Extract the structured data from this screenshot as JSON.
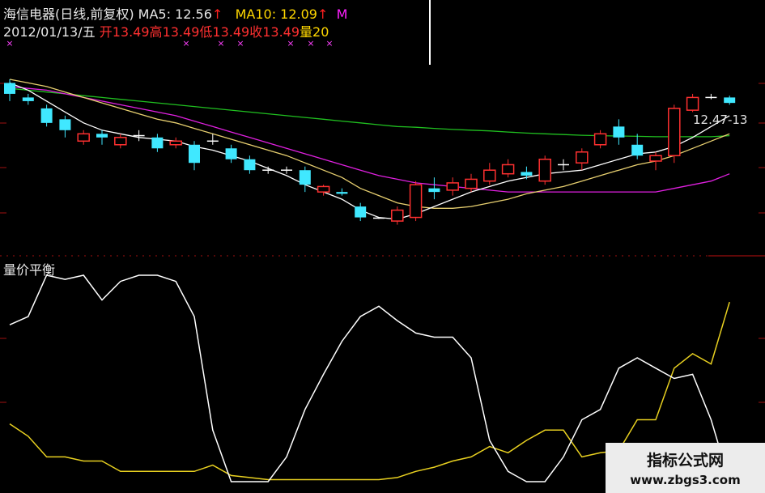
{
  "header": {
    "stock": "海信电器(日线,前复权)",
    "ma5_label": "MA5:",
    "ma5_value": "12.56",
    "ma10_label": "MA10:",
    "ma10_value": "12.09",
    "ma20_label_fragment": "M",
    "up_arrow": "↑",
    "date": "2012/01/13/五",
    "open_label": "开",
    "open_value": "13.49",
    "high_label": "高",
    "high_value": "13.49",
    "low_label": "低",
    "low_value": "13.49",
    "close_label": "收",
    "close_value": "13.49",
    "vol_label": "量",
    "vol_value_fragment": "20"
  },
  "price_label": "12.47-13",
  "sub_indicator_label": "量价平衡",
  "watermark": {
    "title": "指标公式网",
    "url": "www.zbgs3.com"
  },
  "colors": {
    "background": "#000000",
    "up_candle": "#ff3030",
    "down_candle": "#40e8ff",
    "ma5": "#ffffff",
    "ma10": "#e8d070",
    "ma20": "#e020e0",
    "ma60": "#20c020",
    "indicator_white": "#ffffff",
    "indicator_yellow": "#e8d020"
  },
  "chart_data": {
    "type": "candlestick",
    "candles": [
      {
        "o": 13.0,
        "c": 12.7,
        "h": 13.1,
        "l": 12.5
      },
      {
        "o": 12.6,
        "c": 12.5,
        "h": 12.7,
        "l": 12.4
      },
      {
        "o": 12.3,
        "c": 11.9,
        "h": 12.4,
        "l": 11.8
      },
      {
        "o": 12.0,
        "c": 11.7,
        "h": 12.1,
        "l": 11.5
      },
      {
        "o": 11.4,
        "c": 11.6,
        "h": 11.7,
        "l": 11.3
      },
      {
        "o": 11.6,
        "c": 11.5,
        "h": 11.7,
        "l": 11.3
      },
      {
        "o": 11.3,
        "c": 11.5,
        "h": 11.6,
        "l": 11.2
      },
      {
        "o": 11.55,
        "c": 11.55,
        "h": 11.7,
        "l": 11.4
      },
      {
        "o": 11.5,
        "c": 11.2,
        "h": 11.6,
        "l": 11.1
      },
      {
        "o": 11.3,
        "c": 11.4,
        "h": 11.5,
        "l": 11.2
      },
      {
        "o": 11.3,
        "c": 10.8,
        "h": 11.4,
        "l": 10.6
      },
      {
        "o": 11.4,
        "c": 11.4,
        "h": 11.6,
        "l": 11.3
      },
      {
        "o": 11.2,
        "c": 10.9,
        "h": 11.3,
        "l": 10.8
      },
      {
        "o": 10.9,
        "c": 10.6,
        "h": 11.0,
        "l": 10.5
      },
      {
        "o": 10.6,
        "c": 10.6,
        "h": 10.7,
        "l": 10.5
      },
      {
        "o": 10.6,
        "c": 10.6,
        "h": 10.7,
        "l": 10.5
      },
      {
        "o": 10.6,
        "c": 10.2,
        "h": 10.7,
        "l": 10.0
      },
      {
        "o": 10.0,
        "c": 10.15,
        "h": 10.2,
        "l": 9.9
      },
      {
        "o": 10.0,
        "c": 9.95,
        "h": 10.1,
        "l": 9.9
      },
      {
        "o": 9.6,
        "c": 9.3,
        "h": 9.7,
        "l": 9.2
      },
      {
        "o": 9.28,
        "c": 9.28,
        "h": 9.3,
        "l": 9.26
      },
      {
        "o": 9.2,
        "c": 9.5,
        "h": 9.6,
        "l": 9.1
      },
      {
        "o": 9.3,
        "c": 10.2,
        "h": 10.3,
        "l": 9.2
      },
      {
        "o": 10.1,
        "c": 10.0,
        "h": 10.4,
        "l": 9.8
      },
      {
        "o": 10.05,
        "c": 10.25,
        "h": 10.4,
        "l": 9.9
      },
      {
        "o": 10.1,
        "c": 10.35,
        "h": 10.5,
        "l": 10.0
      },
      {
        "o": 10.3,
        "c": 10.6,
        "h": 10.8,
        "l": 10.2
      },
      {
        "o": 10.5,
        "c": 10.75,
        "h": 10.9,
        "l": 10.4
      },
      {
        "o": 10.55,
        "c": 10.45,
        "h": 10.7,
        "l": 10.35
      },
      {
        "o": 10.3,
        "c": 10.9,
        "h": 11.0,
        "l": 10.2
      },
      {
        "o": 10.75,
        "c": 10.75,
        "h": 10.9,
        "l": 10.6
      },
      {
        "o": 10.8,
        "c": 11.1,
        "h": 11.2,
        "l": 10.6
      },
      {
        "o": 11.3,
        "c": 11.6,
        "h": 11.7,
        "l": 11.2
      },
      {
        "o": 11.8,
        "c": 11.5,
        "h": 12.0,
        "l": 11.3
      },
      {
        "o": 11.3,
        "c": 11.0,
        "h": 11.6,
        "l": 10.9
      },
      {
        "o": 10.85,
        "c": 11.0,
        "h": 11.1,
        "l": 10.6
      },
      {
        "o": 11.0,
        "c": 12.3,
        "h": 12.4,
        "l": 10.8
      },
      {
        "o": 12.25,
        "c": 12.6,
        "h": 12.7,
        "l": 12.2
      },
      {
        "o": 12.6,
        "c": 12.6,
        "h": 12.7,
        "l": 12.55
      },
      {
        "o": 12.6,
        "c": 12.45,
        "h": 12.65,
        "l": 12.4
      }
    ],
    "ma_lines": {
      "ma5": [
        13.0,
        12.8,
        12.5,
        12.2,
        11.9,
        11.7,
        11.6,
        11.5,
        11.45,
        11.4,
        11.25,
        11.15,
        11.0,
        10.85,
        10.65,
        10.45,
        10.2,
        10.0,
        9.8,
        9.5,
        9.3,
        9.25,
        9.4,
        9.6,
        9.8,
        10.0,
        10.15,
        10.3,
        10.4,
        10.5,
        10.55,
        10.6,
        10.75,
        10.9,
        11.05,
        11.1,
        11.25,
        11.5,
        11.8,
        12.1
      ],
      "ma10": [
        13.1,
        13.0,
        12.9,
        12.75,
        12.6,
        12.45,
        12.3,
        12.15,
        12.0,
        11.9,
        11.75,
        11.6,
        11.45,
        11.3,
        11.15,
        11.0,
        10.8,
        10.6,
        10.4,
        10.1,
        9.9,
        9.7,
        9.6,
        9.55,
        9.55,
        9.6,
        9.7,
        9.8,
        9.95,
        10.05,
        10.15,
        10.3,
        10.45,
        10.6,
        10.75,
        10.85,
        11.0,
        11.2,
        11.4,
        11.6
      ],
      "ma20": [
        12.9,
        12.85,
        12.8,
        12.7,
        12.6,
        12.5,
        12.4,
        12.3,
        12.2,
        12.1,
        11.95,
        11.8,
        11.65,
        11.5,
        11.35,
        11.2,
        11.05,
        10.9,
        10.75,
        10.6,
        10.45,
        10.35,
        10.25,
        10.2,
        10.15,
        10.1,
        10.05,
        10.0,
        10.0,
        10.0,
        10.0,
        10.0,
        10.0,
        10.0,
        10.0,
        10.0,
        10.1,
        10.2,
        10.3,
        10.5
      ],
      "ma60": [
        12.85,
        12.8,
        12.75,
        12.7,
        12.65,
        12.6,
        12.55,
        12.5,
        12.45,
        12.4,
        12.35,
        12.3,
        12.25,
        12.2,
        12.15,
        12.1,
        12.05,
        12.0,
        11.95,
        11.9,
        11.85,
        11.8,
        11.78,
        11.75,
        11.72,
        11.7,
        11.68,
        11.65,
        11.62,
        11.6,
        11.58,
        11.56,
        11.55,
        11.54,
        11.53,
        11.52,
        11.52,
        11.52,
        11.52,
        11.55
      ]
    },
    "price_ylim": [
      8.6,
      13.5
    ],
    "indicator": {
      "name": "量价平衡",
      "ylim": [
        0,
        100
      ],
      "white": [
        76,
        80,
        100,
        98,
        100,
        88,
        97,
        100,
        100,
        97,
        80,
        25,
        0,
        0,
        0,
        12,
        35,
        52,
        68,
        80,
        85,
        78,
        72,
        70,
        70,
        60,
        20,
        5,
        0,
        0,
        12,
        30,
        35,
        55,
        60,
        55,
        50,
        52,
        30,
        0
      ],
      "yellow": [
        28,
        22,
        12,
        12,
        10,
        10,
        5,
        5,
        5,
        5,
        5,
        8,
        3,
        2,
        1,
        1,
        1,
        1,
        1,
        1,
        1,
        2,
        5,
        7,
        10,
        12,
        17,
        14,
        20,
        25,
        25,
        12,
        14,
        15,
        30,
        30,
        55,
        62,
        57,
        87
      ]
    }
  }
}
